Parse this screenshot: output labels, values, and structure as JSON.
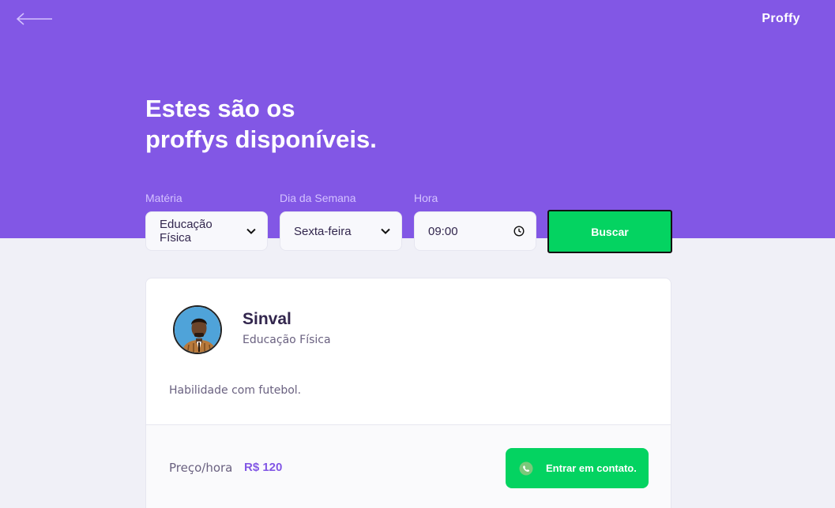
{
  "brand": {
    "logo": "Proffy"
  },
  "header": {
    "title_line1": "Estes são os",
    "title_line2": "proffys disponíveis."
  },
  "filters": {
    "subject": {
      "label": "Matéria",
      "value": "Educação Física"
    },
    "weekday": {
      "label": "Dia da Semana",
      "value": "Sexta-feira"
    },
    "time": {
      "label": "Hora",
      "value": "09:00"
    },
    "search_label": "Buscar"
  },
  "teacher": {
    "name": "Sinval",
    "subject": "Educação Física",
    "bio": "Habilidade com futebol.",
    "price_label": "Preço/hora",
    "price_value": "R$ 120",
    "contact_label": "Entrar em contato."
  },
  "colors": {
    "primary": "#8257E5",
    "secondary": "#04D361",
    "background": "#F0F0F7"
  },
  "icons": [
    "back-arrow-icon",
    "chevron-down-icon",
    "clock-icon",
    "whatsapp-icon"
  ]
}
